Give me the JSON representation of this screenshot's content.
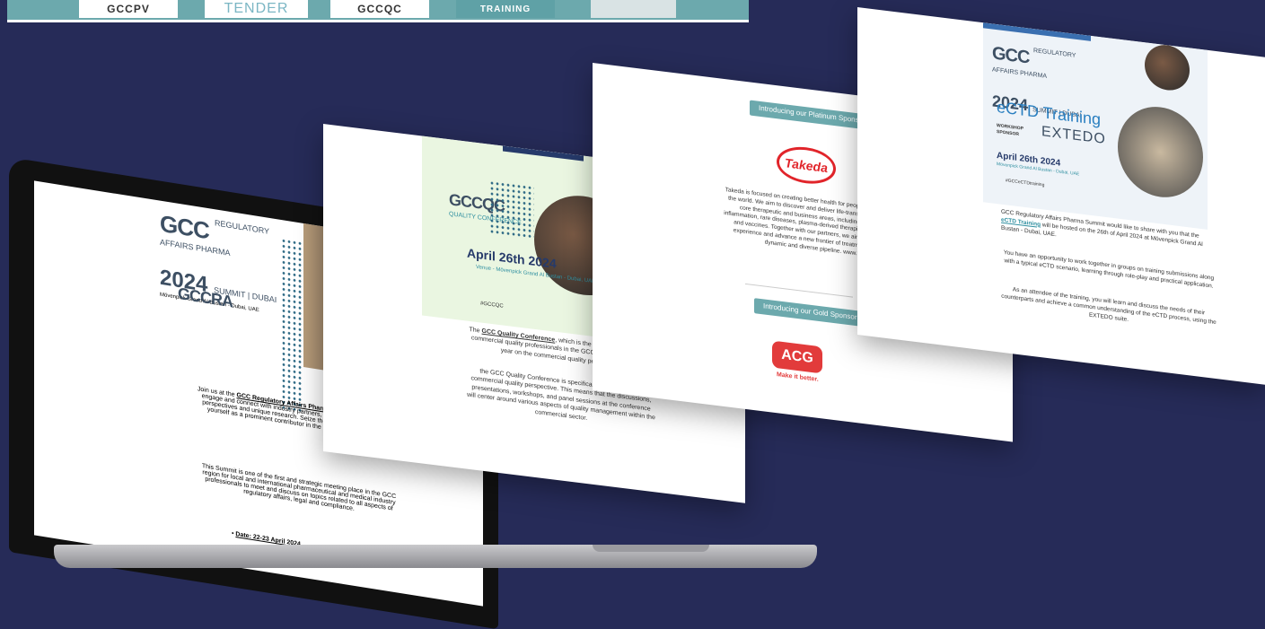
{
  "strip": {
    "thumbs": [
      {
        "label": "GCCPV"
      },
      {
        "label": "TENDER"
      },
      {
        "label": "GCCQC"
      },
      {
        "label": "TRAINING"
      }
    ]
  },
  "laptop_screen": {
    "logo_gcc": "GCC",
    "logo_sub1": "REGULATORY",
    "logo_sub2": "AFFAIRS PHARMA",
    "logo_year": "2024",
    "logo_sub3": "SUMMIT | DUBAI",
    "venue": "Mövenpick Grand Al Bustan - Dubai, UAE",
    "badge": "GCCRA",
    "para1_pre": "Join us at the ",
    "para1_link": "GCC Regulatory Affairs Pharma Summit",
    "para1_post": ", where you can engage and connect with industry partners, presenting your distinctive perspectives and unique research. Seize the opportunity to showcase yourself as a prominent contributor in the pharmaceutical industry.",
    "para2": "This Summit is one of the first and strategic meeting place in the GCC region for local and international pharmaceutical and medical industry professionals to meet and discuss on topics related to all aspects of regulatory affairs, legal and compliance.",
    "date_label": "Date: 22-23 April 2024"
  },
  "card_qc": {
    "logo": "GCCQC",
    "logo_sub": "QUALITY CONFERENCE",
    "date": "April 26th 2024",
    "venue": "Venue - Mövenpick Grand Al Bustan - Dubai, UAE",
    "hashtag": "#GCCQC",
    "para1_pre": "The ",
    "para1_link": "GCC Quality Conference",
    "para1_post": ", which is the first meeting place for commercial quality professionals in the GCC, will be focused this year on the commercial quality perspective.",
    "para2": "the GCC Quality Conference is specifically focusing on the commercial quality perspective. This means that the discussions, presentations, workshops, and panel sessions at the conference will center around various aspects of quality management within the commercial sector."
  },
  "card_sponsor": {
    "pill1": "Introducing our Platinum Sponsor",
    "sponsor1_logo": "Takeda",
    "para": "Takeda is focused on creating better health for people and a brighter future for the world. We aim to discover and deliver life-transforming treatments in our core therapeutic and business areas, including gastrointestinal and inflammation, rare diseases, plasma-derived therapies, oncology, neuroscience and vaccines. Together with our partners, we aim to improve the patient experience and advance a new frontier of treatment options through our dynamic and diverse pipeline. www.takeda.com",
    "pill2": "Introducing our Gold Sponsor",
    "sponsor2_logo": "ACG",
    "sponsor2_tag": "Make it better."
  },
  "card_ectd": {
    "logo_gcc": "GCC",
    "logo_sub1": "REGULATORY",
    "logo_sub2": "AFFAIRS PHARMA",
    "logo_year": "2024",
    "logo_sub3": "SUMMIT | DUBAI",
    "title": "eCTD Training",
    "workshop": "WORKSHOP SPONSOR",
    "sponsor": "EXTEDO",
    "date": "April 26th 2024",
    "venue": "Mövenpick Grand Al Bustan - Dubai, UAE",
    "hashtag": "#GCCeCTDtraining",
    "para1_pre": "GCC Regulatory Affairs Pharma Summit would like to share with you that the ",
    "para1_link": "eCTD Training",
    "para1_post": " will be hosted on the 26th of April 2024 at Mövenpick Grand Al Bustan - Dubai, UAE.",
    "para2": "You have an opportunity to work together in groups on training submissions along with a typical eCTD scenario, learning through role-play and practical application.",
    "para3": "As an attendee of the training, you will learn and discuss the needs of their counterparts and achieve a common understanding of the eCTD process, using the EXTEDO suite."
  },
  "colors": {
    "background": "#262b58",
    "teal": "#6ca9ad",
    "takeda_red": "#e1242a",
    "acg_red": "#e23b3b"
  }
}
